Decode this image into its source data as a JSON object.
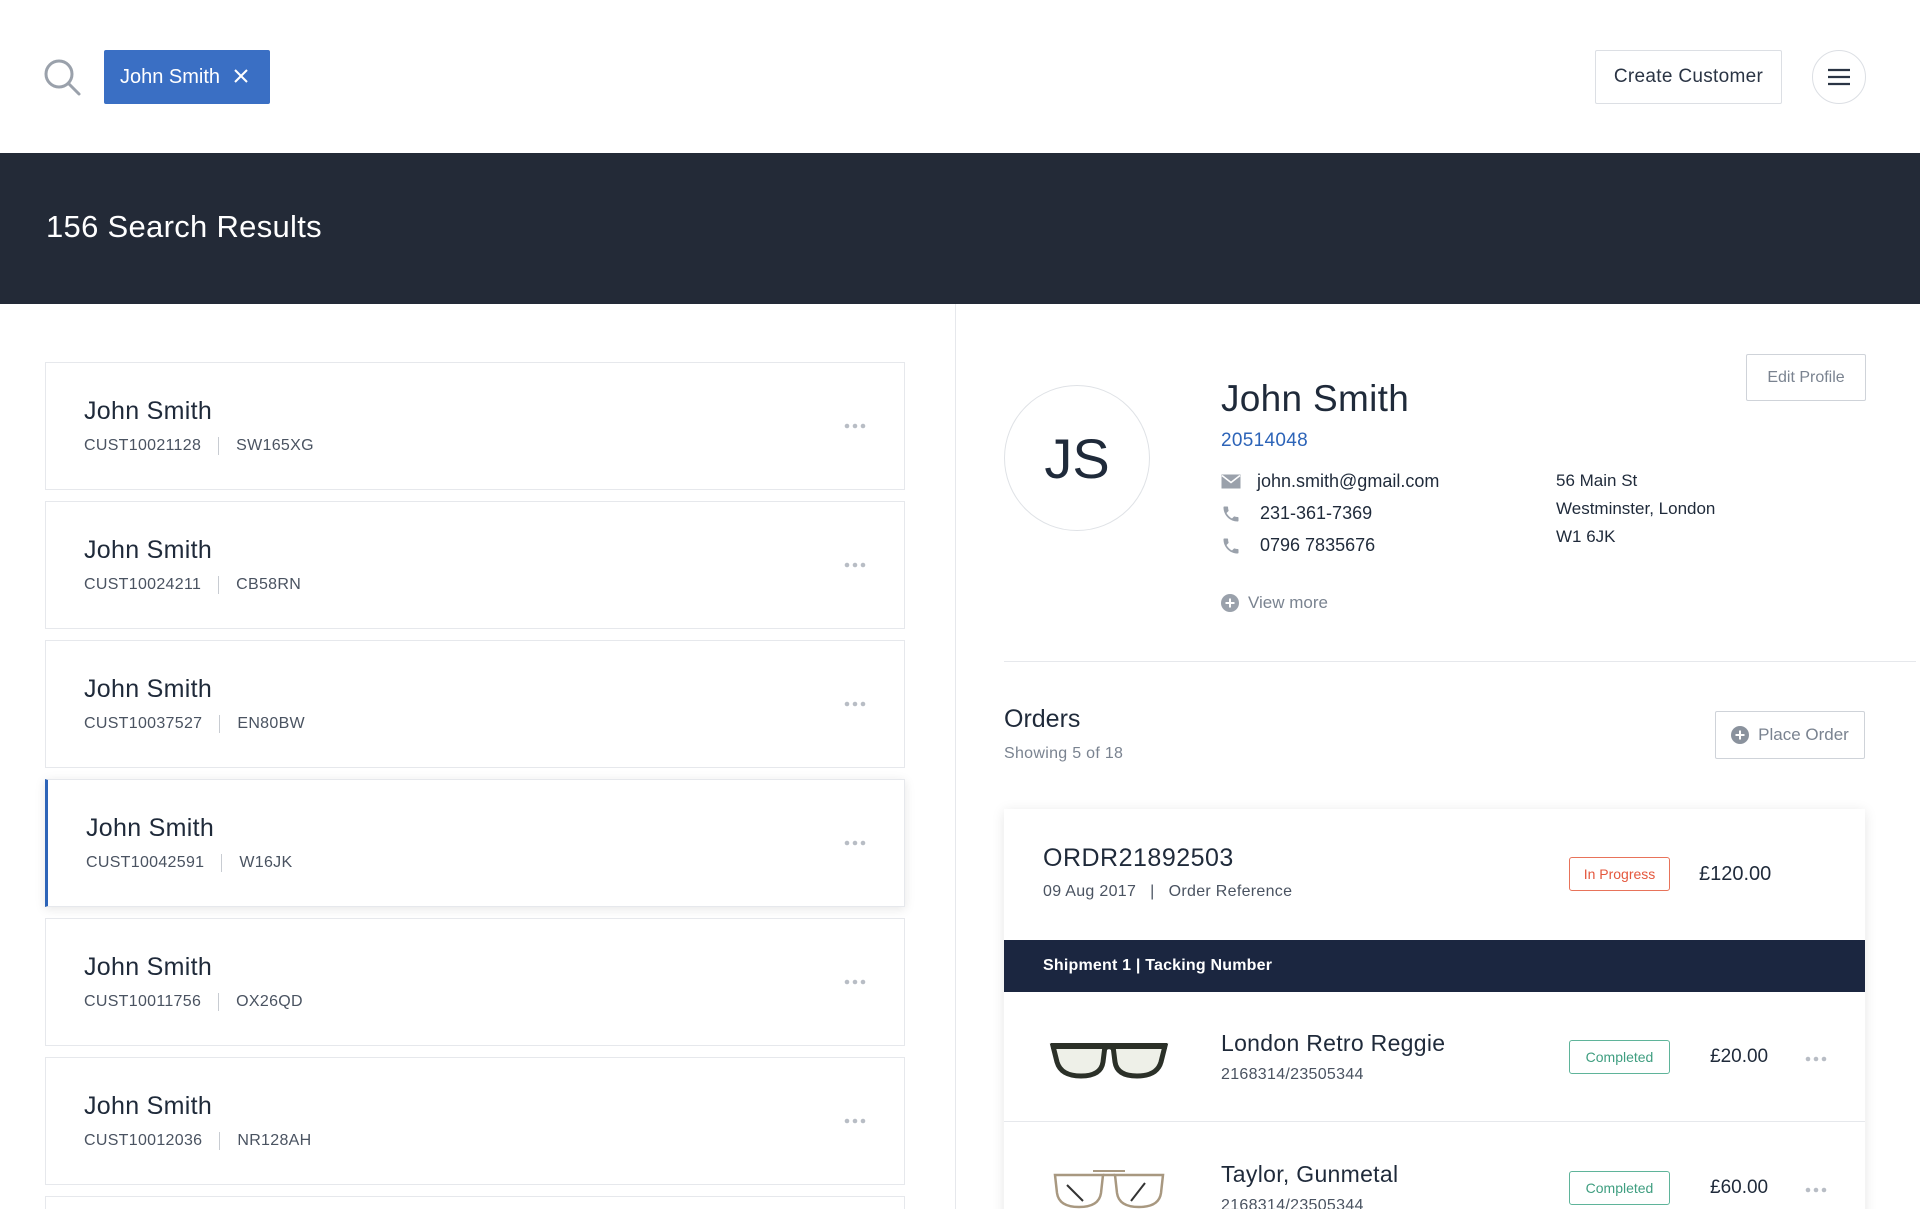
{
  "search": {
    "chip_label": "John Smith"
  },
  "header": {
    "create_label": "Create Customer"
  },
  "banner": {
    "title": "156 Search Results"
  },
  "customers": [
    {
      "name": "John Smith",
      "id": "CUST10021128",
      "postcode": "SW165XG",
      "selected": false
    },
    {
      "name": "John Smith",
      "id": "CUST10024211",
      "postcode": "CB58RN",
      "selected": false
    },
    {
      "name": "John Smith",
      "id": "CUST10037527",
      "postcode": "EN80BW",
      "selected": false
    },
    {
      "name": "John Smith",
      "id": "CUST10042591",
      "postcode": "W16JK",
      "selected": true
    },
    {
      "name": "John Smith",
      "id": "CUST10011756",
      "postcode": "OX26QD",
      "selected": false
    },
    {
      "name": "John Smith",
      "id": "CUST10012036",
      "postcode": "NR128AH",
      "selected": false
    }
  ],
  "profile": {
    "initials": "JS",
    "name": "John Smith",
    "id": "20514048",
    "email": "john.smith@gmail.com",
    "phone1": "231-361-7369",
    "phone2": "0796 7835676",
    "address_line1": "56 Main St",
    "address_line2": "Westminster, London",
    "address_line3": "W1 6JK",
    "view_more": "View more",
    "edit_label": "Edit Profile"
  },
  "orders": {
    "title": "Orders",
    "subtitle": "Showing 5 of 18",
    "place_label": "Place Order",
    "order": {
      "id": "ORDR21892503",
      "date": "09 Aug 2017",
      "reference": "Order Reference",
      "status": "In Progress",
      "price": "£120.00",
      "shipment": "Shipment 1  |  Tacking Number",
      "items": [
        {
          "name": "London Retro Reggie",
          "code": "2168314/23505344",
          "status": "Completed",
          "price": "£20.00",
          "icon": "dark-glasses-icon"
        },
        {
          "name": "Taylor, Gunmetal",
          "code": "2168314/23505344",
          "status": "Completed",
          "price": "£60.00",
          "icon": "wire-glasses-icon"
        }
      ]
    }
  },
  "colors": {
    "accent": "#3a6fc4",
    "banner": "#232a37",
    "shipment_bar": "#1b2640",
    "in_progress": "#e4573d",
    "completed": "#3f9e80"
  }
}
